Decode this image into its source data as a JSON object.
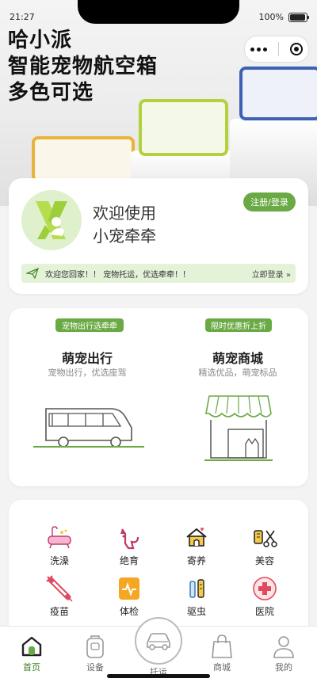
{
  "status_bar": {
    "time": "21:27",
    "battery": "100%"
  },
  "banner": {
    "line1": "哈小派",
    "line2": "智能宠物航空箱",
    "line3": "多色可选"
  },
  "welcome": {
    "line1": "欢迎使用",
    "line2": "小宠牵牵",
    "register_label": "注册/登录"
  },
  "notice": {
    "text": "欢迎您回家！！  宠物托运，优选牵牵！！",
    "action": "立即登录"
  },
  "services": [
    {
      "tag": "宠物出行选牵牵",
      "title": "萌宠出行",
      "subtitle": "宠物出行，优选座驾"
    },
    {
      "tag": "限时优惠折上折",
      "title": "萌宠商城",
      "subtitle": "精选优品，萌宠标品"
    }
  ],
  "grid": [
    {
      "label": "洗澡",
      "icon": "bathtub-icon"
    },
    {
      "label": "绝育",
      "icon": "cat-icon"
    },
    {
      "label": "寄养",
      "icon": "pet-house-icon"
    },
    {
      "label": "美容",
      "icon": "grooming-scissors-icon"
    },
    {
      "label": "疫苗",
      "icon": "syringe-icon"
    },
    {
      "label": "体检",
      "icon": "health-check-icon"
    },
    {
      "label": "驱虫",
      "icon": "deworm-icon"
    },
    {
      "label": "医院",
      "icon": "hospital-cross-icon"
    }
  ],
  "tabs": [
    {
      "label": "首页",
      "icon": "home-icon",
      "active": true
    },
    {
      "label": "设备",
      "icon": "device-icon"
    },
    {
      "label": "托运",
      "icon": "car-icon"
    },
    {
      "label": "商城",
      "icon": "shopping-bag-icon"
    },
    {
      "label": "我的",
      "icon": "user-icon"
    }
  ],
  "colors": {
    "accent": "#6aaa45",
    "notice_bg": "#e4f2d8"
  }
}
